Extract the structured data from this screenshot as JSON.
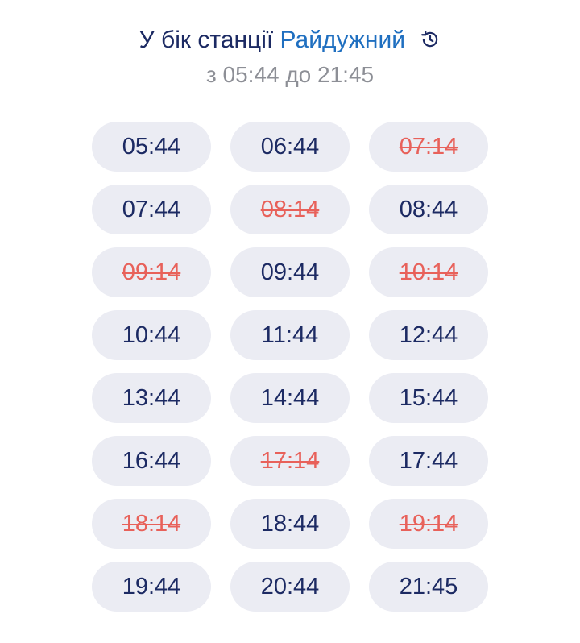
{
  "header": {
    "title_prefix": "У бік станції",
    "station": "Райдужний",
    "subtitle": "з 05:44 до 21:45",
    "history_icon": "history-icon"
  },
  "colors": {
    "text": "#1c2a63",
    "station": "#1f6fc0",
    "subtitle": "#8d8f96",
    "pill_bg": "#ebecf3",
    "cancelled": "#e8615a"
  },
  "departures": [
    {
      "time": "05:44",
      "cancelled": false
    },
    {
      "time": "06:44",
      "cancelled": false
    },
    {
      "time": "07:14",
      "cancelled": true
    },
    {
      "time": "07:44",
      "cancelled": false
    },
    {
      "time": "08:14",
      "cancelled": true
    },
    {
      "time": "08:44",
      "cancelled": false
    },
    {
      "time": "09:14",
      "cancelled": true
    },
    {
      "time": "09:44",
      "cancelled": false
    },
    {
      "time": "10:14",
      "cancelled": true
    },
    {
      "time": "10:44",
      "cancelled": false
    },
    {
      "time": "11:44",
      "cancelled": false
    },
    {
      "time": "12:44",
      "cancelled": false
    },
    {
      "time": "13:44",
      "cancelled": false
    },
    {
      "time": "14:44",
      "cancelled": false
    },
    {
      "time": "15:44",
      "cancelled": false
    },
    {
      "time": "16:44",
      "cancelled": false
    },
    {
      "time": "17:14",
      "cancelled": true
    },
    {
      "time": "17:44",
      "cancelled": false
    },
    {
      "time": "18:14",
      "cancelled": true
    },
    {
      "time": "18:44",
      "cancelled": false
    },
    {
      "time": "19:14",
      "cancelled": true
    },
    {
      "time": "19:44",
      "cancelled": false
    },
    {
      "time": "20:44",
      "cancelled": false
    },
    {
      "time": "21:45",
      "cancelled": false
    }
  ]
}
